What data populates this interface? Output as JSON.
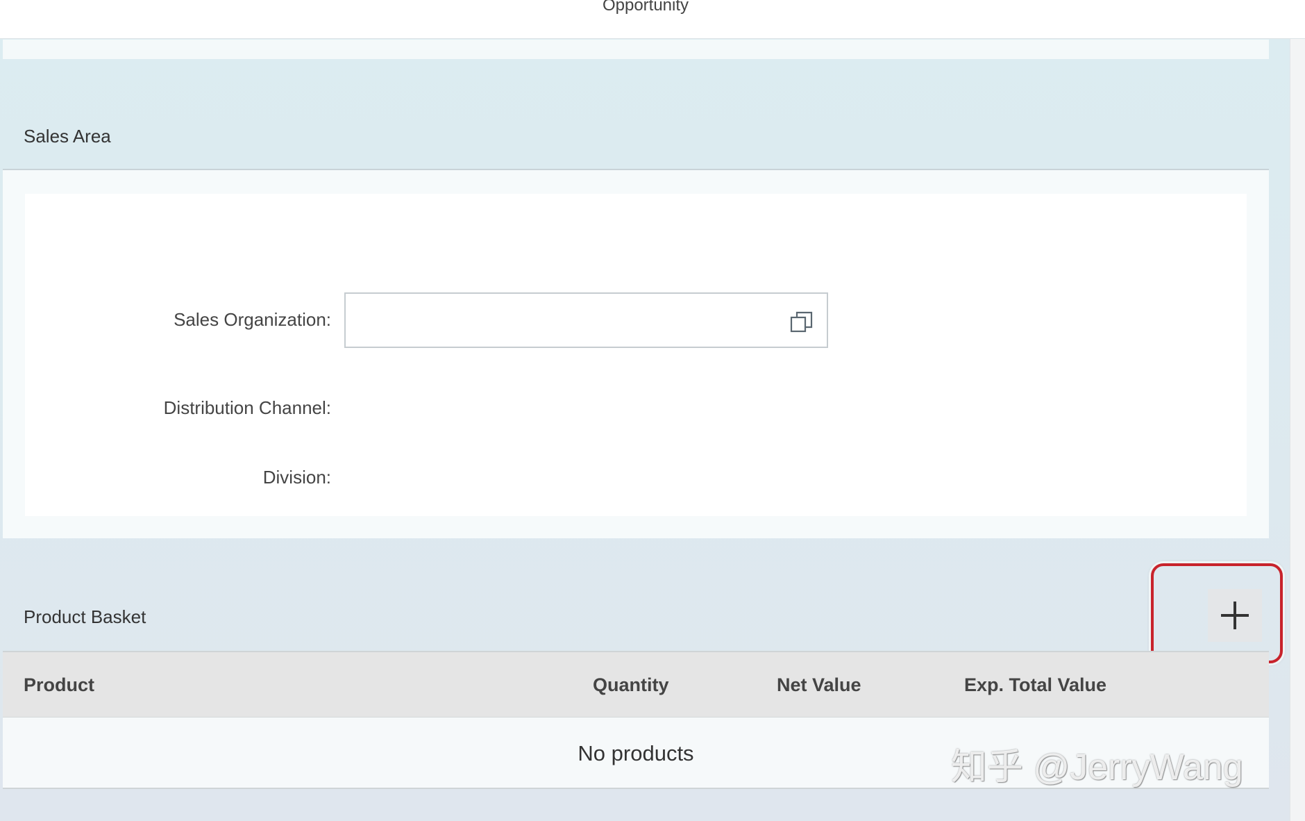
{
  "header": {
    "title": "Opportunity"
  },
  "sales_area": {
    "title": "Sales Area",
    "fields": {
      "sales_organization": {
        "label": "Sales Organization:",
        "value": ""
      },
      "distribution_channel": {
        "label": "Distribution Channel:",
        "value": ""
      },
      "division": {
        "label": "Division:",
        "value": ""
      }
    },
    "value_help_icon": "value-help-icon"
  },
  "product_basket": {
    "title": "Product Basket",
    "add_button_symbol": "+",
    "add_button_icon": "plus-icon",
    "columns": [
      "Product",
      "Quantity",
      "Net Value",
      "Exp. Total Value"
    ],
    "rows": [],
    "empty_text": "No products"
  },
  "colors": {
    "highlight": "#c8232c",
    "page_background": "#dcecf1"
  },
  "watermark": "知乎 @JerryWang"
}
